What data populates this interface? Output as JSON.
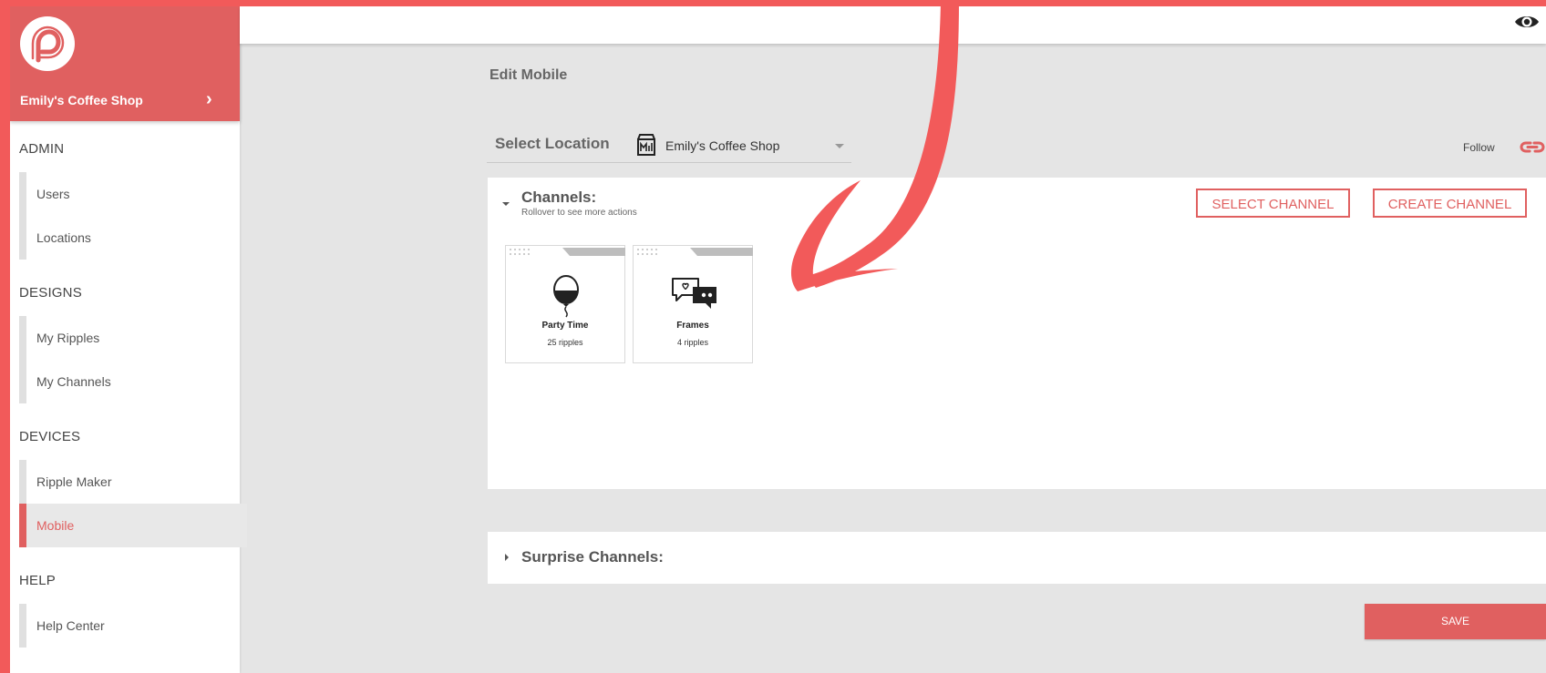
{
  "sidebar": {
    "brand": "Emily's Coffee Shop",
    "chevron": "›",
    "sections": [
      {
        "title": "ADMIN",
        "items": [
          "Users",
          "Locations"
        ]
      },
      {
        "title": "DESIGNS",
        "items": [
          "My Ripples",
          "My Channels"
        ]
      },
      {
        "title": "DEVICES",
        "items": [
          "Ripple Maker",
          "Mobile"
        ]
      },
      {
        "title": "HELP",
        "items": [
          "Help Center"
        ]
      }
    ],
    "active_item": "Mobile"
  },
  "page": {
    "title": "Edit Mobile"
  },
  "location": {
    "label": "Select Location",
    "value": "Emily's Coffee Shop",
    "follow_label": "Follow"
  },
  "channels": {
    "title": "Channels:",
    "subtitle": "Rollover to see more actions",
    "select_button": "SELECT CHANNEL",
    "create_button": "CREATE CHANNEL",
    "cards": [
      {
        "name": "Party Time",
        "count": "25 ripples",
        "icon": "balloon-icon"
      },
      {
        "name": "Frames",
        "count": "4 ripples",
        "icon": "chat-bubbles-icon"
      }
    ]
  },
  "surprise": {
    "title": "Surprise Channels:"
  },
  "save_label": "SAVE",
  "colors": {
    "accent": "#e06060",
    "background_border": "#f25a5a",
    "content_bg": "#e5e5e5"
  }
}
